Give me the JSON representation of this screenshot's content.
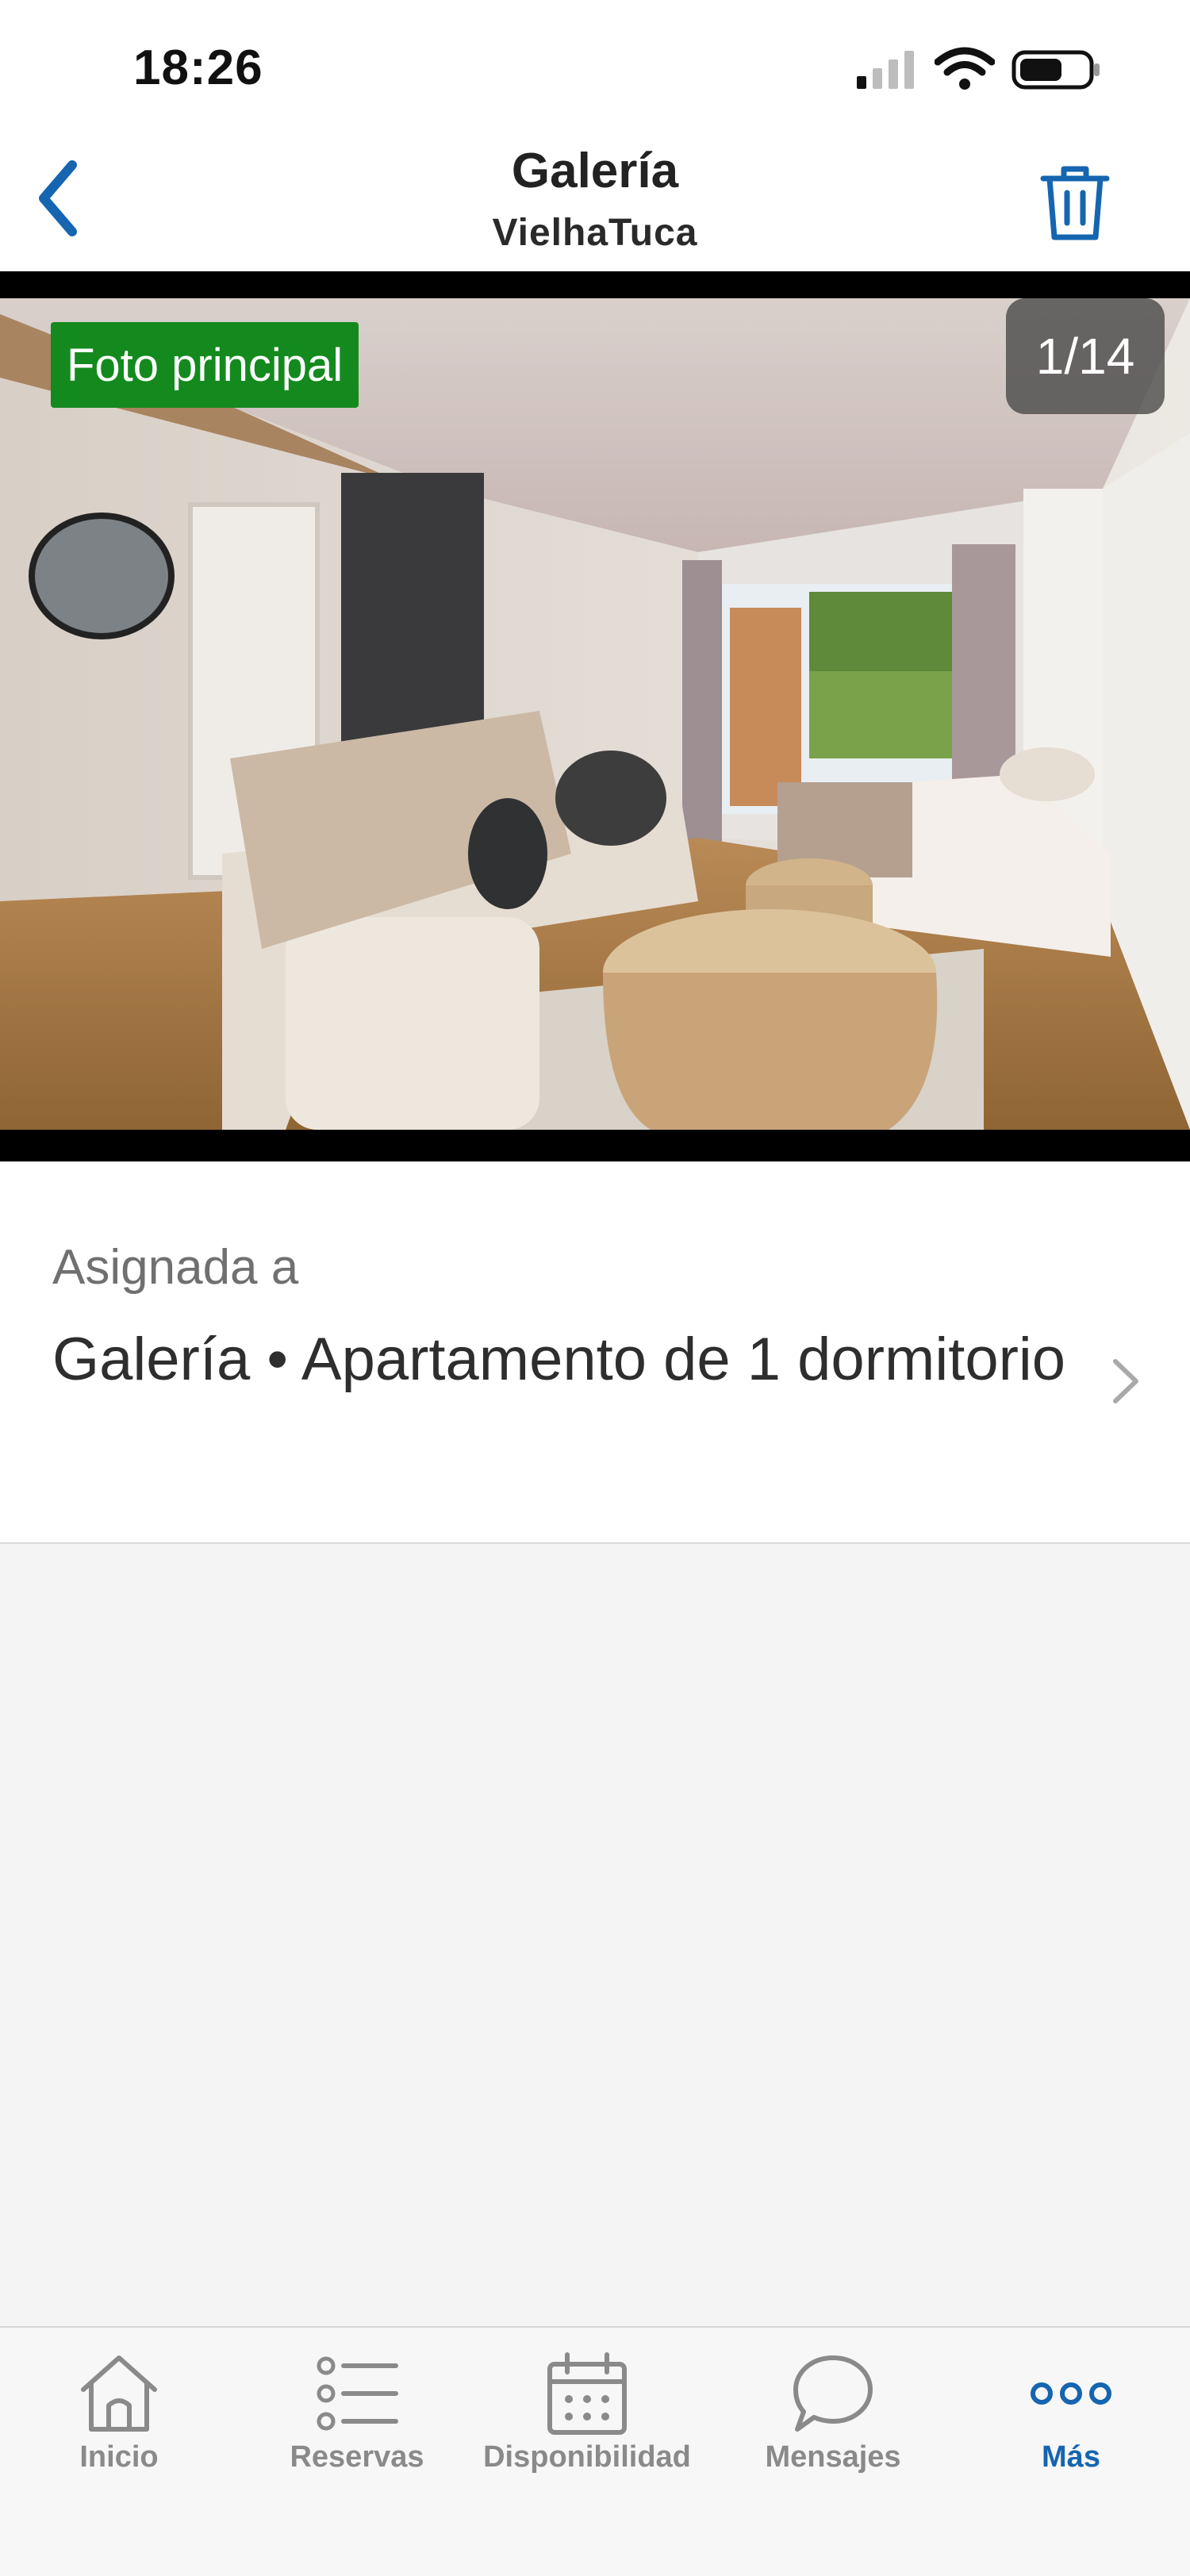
{
  "status_bar": {
    "time": "18:26",
    "icons": [
      "signal-icon",
      "wifi-icon",
      "battery-icon"
    ]
  },
  "header": {
    "title": "Galería",
    "subtitle": "VielhaTuca",
    "back_icon": "chevron-left-icon",
    "delete_icon": "trash-icon"
  },
  "photo": {
    "badge": "Foto principal",
    "counter": "1/14"
  },
  "assigned": {
    "label": "Asignada a",
    "value": "Galería • Apartamento de 1 dormitorio"
  },
  "tabs": [
    {
      "label": "Inicio",
      "icon": "home-icon",
      "active": false
    },
    {
      "label": "Reservas",
      "icon": "list-icon",
      "active": false
    },
    {
      "label": "Disponibilidad",
      "icon": "calendar-icon",
      "active": false
    },
    {
      "label": "Mensajes",
      "icon": "chat-bubble-icon",
      "active": false
    },
    {
      "label": "Más",
      "icon": "more-dots-icon",
      "active": true
    }
  ],
  "colors": {
    "accent": "#1565b0",
    "badge_green": "#148a1e",
    "background": "#f4f4f4"
  }
}
